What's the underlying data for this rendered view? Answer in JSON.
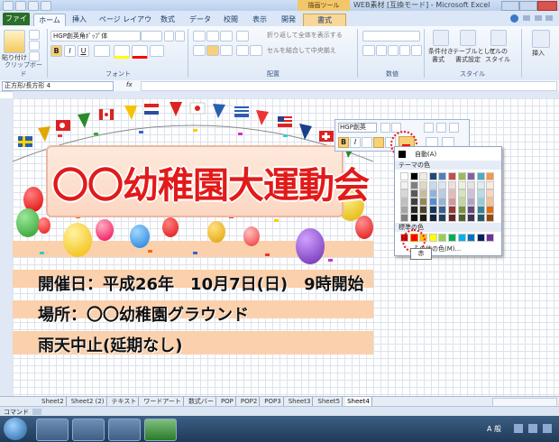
{
  "titlebar": {
    "title": "WEB素材 [互換モード] - Microsoft Excel",
    "context_group": "描画ツール"
  },
  "tabs": [
    "ファイル",
    "ホーム",
    "挿入",
    "ページ レイアウト",
    "数式",
    "データ",
    "校閲",
    "表示",
    "開発",
    "書式"
  ],
  "ribbon": {
    "paste": "貼り付け",
    "clipboard_group": "クリップボード",
    "font_name": "HGP創英角ﾎﾟｯﾌﾟ体",
    "font_group": "フォント",
    "wrap_text": "折り返して全体を表示する",
    "merge_center": "セルを結合して中央揃え",
    "align_group": "配置",
    "number_group": "数値",
    "cond_format": [
      "条件付き",
      "書式"
    ],
    "table_format": [
      "テーブルとして",
      "書式設定"
    ],
    "cell_style": [
      "セルの",
      "スタイル"
    ],
    "style_group": "スタイル",
    "insert": "挿入"
  },
  "formula_bar": {
    "name_box": "正方形/長方形 4",
    "fx": "fx"
  },
  "poster": {
    "title": "〇〇幼稚園大運動会",
    "line1": "開催日：平成26年　10月7日(日)　9時開始",
    "line2": "場所：〇〇幼稚園グラウンド",
    "line3": "雨天中止(延期なし)"
  },
  "mini_toolbar": {
    "font": "HGP創英"
  },
  "palette": {
    "auto": "自動(A)",
    "theme_label": "テーマの色",
    "standard_label": "標準の色",
    "more": "その他の色(M)...",
    "tooltip": "赤",
    "theme_colors": [
      [
        "#ffffff",
        "#000000",
        "#eeece1",
        "#1f497d",
        "#4f81bd",
        "#c0504d",
        "#9bbb59",
        "#8064a2",
        "#4bacc6",
        "#f79646"
      ],
      [
        "#f2f2f2",
        "#7f7f7f",
        "#ddd9c3",
        "#c6d9f0",
        "#dbe5f1",
        "#f2dcdb",
        "#ebf1dd",
        "#e5e0ec",
        "#dbeef3",
        "#fdeada"
      ],
      [
        "#d8d8d8",
        "#595959",
        "#c4bd97",
        "#8db3e2",
        "#b8cce4",
        "#e5b9b7",
        "#d7e3bc",
        "#ccc1d9",
        "#b7dde8",
        "#fbd5b5"
      ],
      [
        "#bfbfbf",
        "#3f3f3f",
        "#938953",
        "#548dd4",
        "#95b3d7",
        "#d99694",
        "#c3d69b",
        "#b2a2c7",
        "#92cddc",
        "#fac08f"
      ],
      [
        "#a5a5a5",
        "#262626",
        "#494429",
        "#17365d",
        "#366092",
        "#953734",
        "#76923c",
        "#5f497a",
        "#31859b",
        "#e36c09"
      ],
      [
        "#7f7f7f",
        "#0c0c0c",
        "#1d1b10",
        "#0f243e",
        "#244061",
        "#632423",
        "#4f6128",
        "#3f3151",
        "#205867",
        "#974806"
      ]
    ],
    "standard_colors": [
      "#c00000",
      "#ff0000",
      "#ffc000",
      "#ffff00",
      "#92d050",
      "#00b050",
      "#00b0f0",
      "#0070c0",
      "#002060",
      "#7030a0"
    ]
  },
  "sheet_tabs": [
    "Sheet2",
    "Sheet2 (2)",
    "テキスト",
    "ワードアート",
    "数式バー",
    "POP",
    "POP2",
    "POP3",
    "Sheet3",
    "Sheet5",
    "Sheet4"
  ],
  "active_sheet": "Sheet4",
  "status": "コマンド",
  "taskbar": {
    "tray": "A 般"
  }
}
